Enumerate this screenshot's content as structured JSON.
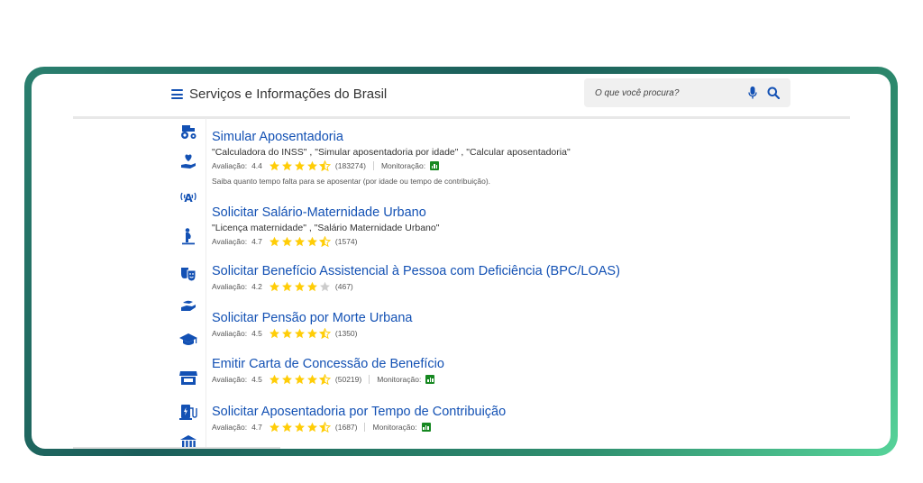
{
  "header": {
    "brand_title": "Serviços e Informações do Brasil",
    "search_placeholder": "O que você procura?"
  },
  "colors": {
    "primary_blue": "#1351b4",
    "star_gold": "#ffcd07",
    "star_empty": "#cccccc",
    "monitor_green": "#168821",
    "frame_start": "#1b5e5a",
    "frame_end": "#57d49a"
  },
  "side_icons": [
    "tractor-icon",
    "heart-hand-icon",
    "antenna-icon",
    "pregnant-icon",
    "theater-masks-icon",
    "hand-coin-icon",
    "graduation-cap-icon",
    "store-icon",
    "charging-station-icon",
    "bank-icon"
  ],
  "services": [
    {
      "title": "Simular Aposentadoria",
      "keywords": "\"Calculadora do INSS\" , \"Simular aposentadoria por idade\" , \"Calcular aposentadoria\"",
      "rating_label": "Avaliação:",
      "rating": "4.4",
      "rating_value": 4.4,
      "reviews": "(183274)",
      "monitor_label": "Monitoração:",
      "description": "Saiba quanto tempo falta para se aposentar (por idade ou tempo de contribuição)."
    },
    {
      "title": "Solicitar Salário-Maternidade Urbano",
      "keywords": "\"Licença maternidade\" , \"Salário Maternidade Urbano\"",
      "rating_label": "Avaliação:",
      "rating": "4.7",
      "rating_value": 4.7,
      "reviews": "(1574)"
    },
    {
      "title": "Solicitar Benefício Assistencial à Pessoa com Deficiência (BPC/LOAS)",
      "rating_label": "Avaliação:",
      "rating": "4.2",
      "rating_value": 4.2,
      "reviews": "(467)"
    },
    {
      "title": "Solicitar Pensão por Morte Urbana",
      "rating_label": "Avaliação:",
      "rating": "4.5",
      "rating_value": 4.5,
      "reviews": "(1350)"
    },
    {
      "title": "Emitir Carta de Concessão de Benefício",
      "rating_label": "Avaliação:",
      "rating": "4.5",
      "rating_value": 4.5,
      "reviews": "(50219)",
      "monitor_label": "Monitoração:"
    },
    {
      "title": "Solicitar Aposentadoria por Tempo de Contribuição",
      "rating_label": "Avaliação:",
      "rating": "4.7",
      "rating_value": 4.7,
      "reviews": "(1687)",
      "monitor_label": "Monitoração:"
    }
  ]
}
